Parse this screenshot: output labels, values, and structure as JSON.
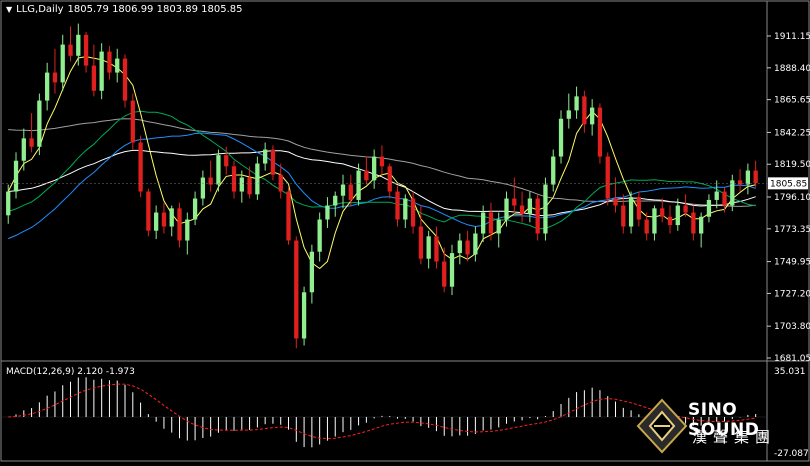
{
  "header": {
    "symbol": "LLG,Daily",
    "ohlc": "1805.79 1806.99 1803.89 1805.85"
  },
  "macd": {
    "label": "MACD(12,26,9) 2.120 -1.973",
    "axis_top": "35.031",
    "axis_bottom": "-27.087"
  },
  "colors": {
    "background": "#000000",
    "up_candle": "#90EE90",
    "down_candle": "#E0201E",
    "ma_fast": "#FFFF66",
    "ma_mid": "#00AA55",
    "ma_blue": "#1E90FF",
    "ma_white": "#FFFFFF",
    "ma_grey": "#A0A0A0",
    "macd_hist": "#FFFFFF",
    "macd_signal": "#FF2020"
  },
  "logo": {
    "name_en": "SINO SOUND",
    "name_cn": "漢聲集團"
  },
  "chart_data": {
    "type": "candlestick",
    "symbol": "LLG",
    "timeframe": "Daily",
    "price_axis_ticks": [
      "1911.15",
      "1888.40",
      "1865.65",
      "1842.25",
      "1819.50",
      "1796.10",
      "1773.35",
      "1749.95",
      "1727.20",
      "1703.80",
      "1681.05"
    ],
    "ylim": [
      1681.05,
      1924
    ],
    "current_price": "1805.85",
    "candles": [
      [
        1783,
        1805,
        1777,
        1800
      ],
      [
        1800,
        1828,
        1795,
        1822
      ],
      [
        1822,
        1845,
        1815,
        1838
      ],
      [
        1838,
        1856,
        1828,
        1832
      ],
      [
        1832,
        1870,
        1826,
        1865
      ],
      [
        1865,
        1892,
        1858,
        1885
      ],
      [
        1885,
        1902,
        1870,
        1878
      ],
      [
        1878,
        1912,
        1872,
        1905
      ],
      [
        1905,
        1918,
        1893,
        1897
      ],
      [
        1897,
        1920,
        1890,
        1912
      ],
      [
        1912,
        1914,
        1885,
        1890
      ],
      [
        1890,
        1905,
        1868,
        1872
      ],
      [
        1872,
        1906,
        1866,
        1900
      ],
      [
        1900,
        1904,
        1880,
        1885
      ],
      [
        1885,
        1902,
        1878,
        1895
      ],
      [
        1895,
        1898,
        1860,
        1865
      ],
      [
        1865,
        1870,
        1830,
        1835
      ],
      [
        1835,
        1840,
        1796,
        1800
      ],
      [
        1800,
        1802,
        1768,
        1772
      ],
      [
        1772,
        1790,
        1766,
        1785
      ],
      [
        1785,
        1792,
        1770,
        1775
      ],
      [
        1775,
        1790,
        1768,
        1788
      ],
      [
        1788,
        1792,
        1760,
        1765
      ],
      [
        1765,
        1785,
        1755,
        1780
      ],
      [
        1780,
        1800,
        1776,
        1795
      ],
      [
        1795,
        1815,
        1790,
        1810
      ],
      [
        1810,
        1822,
        1800,
        1805
      ],
      [
        1805,
        1830,
        1800,
        1826
      ],
      [
        1826,
        1832,
        1812,
        1818
      ],
      [
        1818,
        1822,
        1795,
        1800
      ],
      [
        1800,
        1815,
        1792,
        1810
      ],
      [
        1810,
        1818,
        1795,
        1798
      ],
      [
        1798,
        1825,
        1794,
        1820
      ],
      [
        1820,
        1835,
        1815,
        1830
      ],
      [
        1830,
        1833,
        1808,
        1812
      ],
      [
        1812,
        1820,
        1795,
        1800
      ],
      [
        1800,
        1803,
        1762,
        1765
      ],
      [
        1765,
        1768,
        1688,
        1695
      ],
      [
        1695,
        1732,
        1690,
        1728
      ],
      [
        1728,
        1762,
        1720,
        1757
      ],
      [
        1757,
        1785,
        1750,
        1780
      ],
      [
        1780,
        1796,
        1774,
        1790
      ],
      [
        1790,
        1800,
        1782,
        1797
      ],
      [
        1797,
        1812,
        1788,
        1805
      ],
      [
        1805,
        1812,
        1790,
        1794
      ],
      [
        1794,
        1820,
        1790,
        1815
      ],
      [
        1815,
        1825,
        1805,
        1808
      ],
      [
        1808,
        1830,
        1802,
        1825
      ],
      [
        1825,
        1833,
        1812,
        1818
      ],
      [
        1818,
        1820,
        1795,
        1800
      ],
      [
        1800,
        1804,
        1775,
        1780
      ],
      [
        1780,
        1798,
        1774,
        1795
      ],
      [
        1795,
        1800,
        1770,
        1775
      ],
      [
        1775,
        1790,
        1748,
        1752
      ],
      [
        1752,
        1772,
        1745,
        1768
      ],
      [
        1768,
        1775,
        1745,
        1750
      ],
      [
        1750,
        1760,
        1728,
        1732
      ],
      [
        1732,
        1762,
        1726,
        1756
      ],
      [
        1756,
        1770,
        1748,
        1765
      ],
      [
        1765,
        1772,
        1750,
        1755
      ],
      [
        1755,
        1775,
        1750,
        1770
      ],
      [
        1770,
        1790,
        1764,
        1785
      ],
      [
        1785,
        1792,
        1765,
        1770
      ],
      [
        1770,
        1785,
        1760,
        1780
      ],
      [
        1780,
        1800,
        1775,
        1795
      ],
      [
        1795,
        1810,
        1785,
        1790
      ],
      [
        1790,
        1800,
        1778,
        1784
      ],
      [
        1784,
        1800,
        1778,
        1795
      ],
      [
        1795,
        1798,
        1765,
        1770
      ],
      [
        1770,
        1810,
        1765,
        1805
      ],
      [
        1805,
        1830,
        1800,
        1825
      ],
      [
        1825,
        1858,
        1820,
        1852
      ],
      [
        1852,
        1870,
        1845,
        1858
      ],
      [
        1858,
        1875,
        1852,
        1868
      ],
      [
        1868,
        1872,
        1842,
        1848
      ],
      [
        1848,
        1866,
        1840,
        1860
      ],
      [
        1860,
        1863,
        1820,
        1825
      ],
      [
        1825,
        1828,
        1790,
        1795
      ],
      [
        1795,
        1810,
        1785,
        1790
      ],
      [
        1790,
        1798,
        1770,
        1775
      ],
      [
        1775,
        1800,
        1770,
        1796
      ],
      [
        1796,
        1800,
        1775,
        1780
      ],
      [
        1780,
        1785,
        1765,
        1770
      ],
      [
        1770,
        1790,
        1765,
        1788
      ],
      [
        1788,
        1795,
        1778,
        1782
      ],
      [
        1782,
        1790,
        1770,
        1776
      ],
      [
        1776,
        1795,
        1772,
        1790
      ],
      [
        1790,
        1798,
        1782,
        1785
      ],
      [
        1785,
        1790,
        1765,
        1770
      ],
      [
        1770,
        1785,
        1760,
        1782
      ],
      [
        1782,
        1798,
        1778,
        1794
      ],
      [
        1794,
        1808,
        1788,
        1800
      ],
      [
        1800,
        1803,
        1785,
        1790
      ],
      [
        1790,
        1812,
        1786,
        1808
      ],
      [
        1808,
        1816,
        1800,
        1805
      ],
      [
        1805,
        1820,
        1798,
        1815
      ],
      [
        1815,
        1822,
        1803,
        1806
      ]
    ]
  }
}
